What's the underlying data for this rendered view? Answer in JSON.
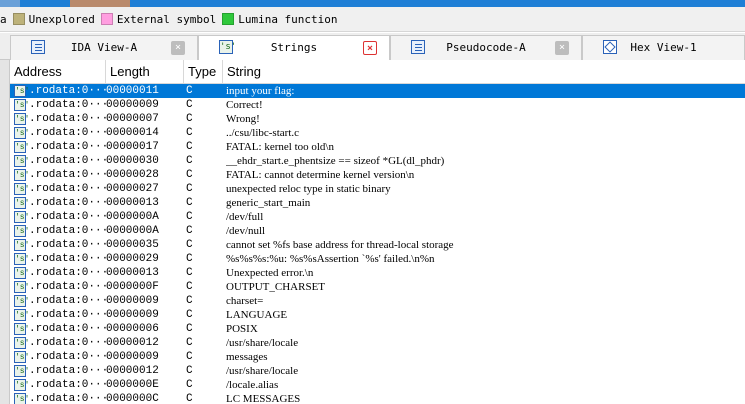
{
  "colors": {
    "nav_blue": "#1f7fd6",
    "nav_brown": "#b98a6c",
    "selection": "#0078d7"
  },
  "legend": {
    "items": [
      {
        "label": "a",
        "color": "#6aa0d8"
      },
      {
        "label": "Unexplored",
        "color": "#bdb27a"
      },
      {
        "label": "External symbol",
        "color": "#ff9ee0"
      },
      {
        "label": "Lumina function",
        "color": "#2fc83b"
      }
    ]
  },
  "tabs": [
    {
      "label": "IDA View-A",
      "icon": "document-icon",
      "close": "×"
    },
    {
      "label": "Strings",
      "icon": "strings-icon",
      "close": "×"
    },
    {
      "label": "Pseudocode-A",
      "icon": "document-icon",
      "close": "×"
    },
    {
      "label": "Hex View-1",
      "icon": "hex-icon"
    }
  ],
  "table": {
    "columns": [
      "Address",
      "Length",
      "Type",
      "String"
    ],
    "icon_glyph": "'s'",
    "rows": [
      {
        "address": ".rodata:0···",
        "length": "00000011",
        "type": "C",
        "string": "input your flag:"
      },
      {
        "address": ".rodata:0···",
        "length": "00000009",
        "type": "C",
        "string": "Correct!"
      },
      {
        "address": ".rodata:0···",
        "length": "00000007",
        "type": "C",
        "string": "Wrong!"
      },
      {
        "address": ".rodata:0···",
        "length": "00000014",
        "type": "C",
        "string": "../csu/libc-start.c"
      },
      {
        "address": ".rodata:0···",
        "length": "00000017",
        "type": "C",
        "string": "FATAL: kernel too old\\n"
      },
      {
        "address": ".rodata:0···",
        "length": "00000030",
        "type": "C",
        "string": "__ehdr_start.e_phentsize == sizeof *GL(dl_phdr)"
      },
      {
        "address": ".rodata:0···",
        "length": "00000028",
        "type": "C",
        "string": "FATAL: cannot determine kernel version\\n"
      },
      {
        "address": ".rodata:0···",
        "length": "00000027",
        "type": "C",
        "string": "unexpected reloc type in static binary"
      },
      {
        "address": ".rodata:0···",
        "length": "00000013",
        "type": "C",
        "string": "generic_start_main"
      },
      {
        "address": ".rodata:0···",
        "length": "0000000A",
        "type": "C",
        "string": "/dev/full"
      },
      {
        "address": ".rodata:0···",
        "length": "0000000A",
        "type": "C",
        "string": "/dev/null"
      },
      {
        "address": ".rodata:0···",
        "length": "00000035",
        "type": "C",
        "string": "cannot set %fs base address for thread-local storage"
      },
      {
        "address": ".rodata:0···",
        "length": "00000029",
        "type": "C",
        "string": "%s%s%s:%u: %s%sAssertion `%s' failed.\\n%n"
      },
      {
        "address": ".rodata:0···",
        "length": "00000013",
        "type": "C",
        "string": "Unexpected error.\\n"
      },
      {
        "address": ".rodata:0···",
        "length": "0000000F",
        "type": "C",
        "string": "OUTPUT_CHARSET"
      },
      {
        "address": ".rodata:0···",
        "length": "00000009",
        "type": "C",
        "string": "charset="
      },
      {
        "address": ".rodata:0···",
        "length": "00000009",
        "type": "C",
        "string": "LANGUAGE"
      },
      {
        "address": ".rodata:0···",
        "length": "00000006",
        "type": "C",
        "string": "POSIX"
      },
      {
        "address": ".rodata:0···",
        "length": "00000012",
        "type": "C",
        "string": "/usr/share/locale"
      },
      {
        "address": ".rodata:0···",
        "length": "00000009",
        "type": "C",
        "string": "messages"
      },
      {
        "address": ".rodata:0···",
        "length": "00000012",
        "type": "C",
        "string": "/usr/share/locale"
      },
      {
        "address": ".rodata:0···",
        "length": "0000000E",
        "type": "C",
        "string": "/locale.alias"
      },
      {
        "address": ".rodata:0···",
        "length": "0000000C",
        "type": "C",
        "string": "LC MESSAGES"
      }
    ]
  }
}
